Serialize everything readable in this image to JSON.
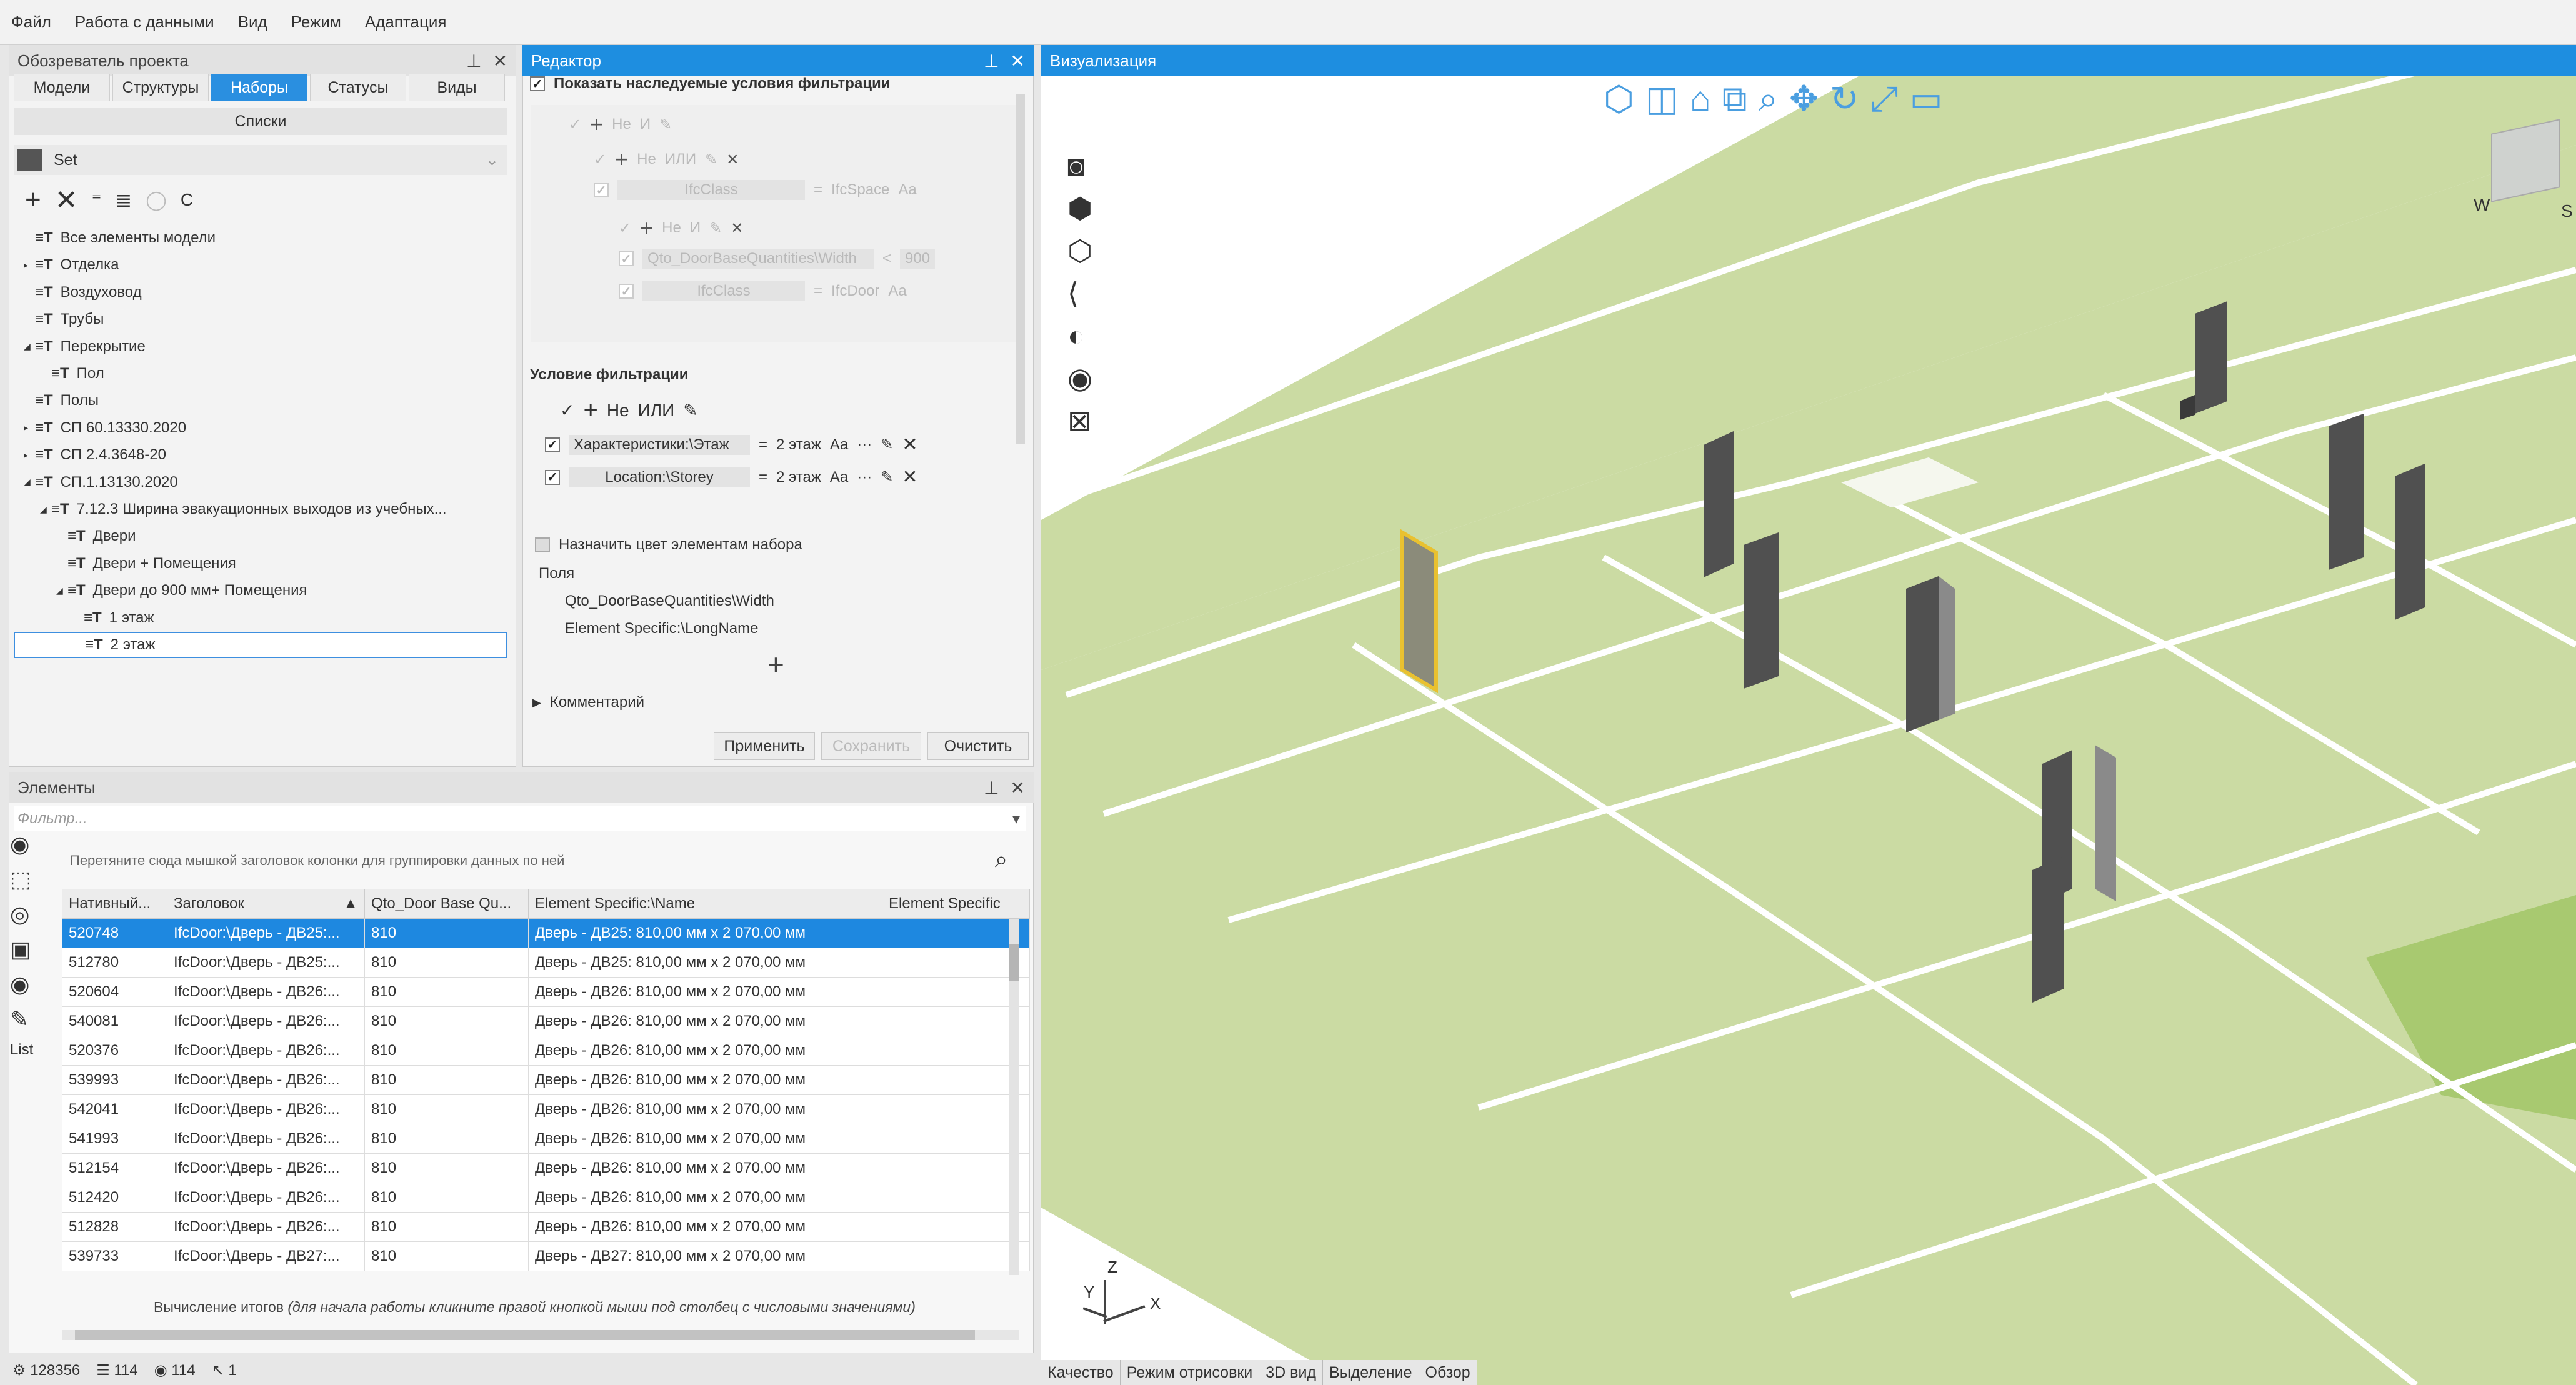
{
  "menu": [
    "Файл",
    "Работа с данными",
    "Вид",
    "Режим",
    "Адаптация"
  ],
  "explorer": {
    "title": "Обозреватель проекта",
    "tabs": [
      "Модели",
      "Структуры",
      "Наборы",
      "Статусы",
      "Виды"
    ],
    "active_tab": "Наборы",
    "subheader": "Списки",
    "set_label": "Set",
    "toolbar_c": "C",
    "tree": [
      {
        "label": "Все элементы модели",
        "depth": 0
      },
      {
        "label": "Отделка",
        "depth": 0
      },
      {
        "label": "Воздуховод",
        "depth": 0
      },
      {
        "label": "Трубы",
        "depth": 0
      },
      {
        "label": "Перекрытие",
        "depth": 0
      },
      {
        "label": "Пол",
        "depth": 1
      },
      {
        "label": "Полы",
        "depth": 0
      },
      {
        "label": "СП 60.13330.2020",
        "depth": 0
      },
      {
        "label": "СП 2.4.3648-20",
        "depth": 0
      },
      {
        "label": "СП.1.13130.2020",
        "depth": 0
      },
      {
        "label": "7.12.3 Ширина эвакуационных выходов из учебных...",
        "depth": 1
      },
      {
        "label": "Двери",
        "depth": 2
      },
      {
        "label": "Двери + Помещения",
        "depth": 2
      },
      {
        "label": "Двери до 900 мм+ Помещения",
        "depth": 2
      },
      {
        "label": "1 этаж",
        "depth": 3
      },
      {
        "label": "2 этаж",
        "depth": 3
      }
    ]
  },
  "editor": {
    "title": "Редактор",
    "show_inherited": "Показать наследуемые условия фильтрации",
    "ops": {
      "not": "Не",
      "and": "И",
      "or": "ИЛИ"
    },
    "inherited": [
      {
        "field": "IfcClass",
        "value": "IfcSpace",
        "case": "Aa"
      },
      {
        "field": "Qto_DoorBaseQuantities\\Width",
        "op": "<",
        "value": "900"
      },
      {
        "field": "IfcClass",
        "value": "IfcDoor",
        "case": "Aa"
      }
    ],
    "condition_title": "Условие фильтрации",
    "conditions": [
      {
        "field": "Характеристики:\\Этаж",
        "op": "=",
        "value": "2 этаж",
        "case": "Aa"
      },
      {
        "field": "Location:\\Storey",
        "op": "=",
        "value": "2 этаж",
        "case": "Aa"
      }
    ],
    "assign_color": "Назначить цвет элементам набора",
    "fields_label": "Поля",
    "fields": [
      "Qto_DoorBaseQuantities\\Width",
      "Element Specific:\\LongName"
    ],
    "comment": "Комментарий",
    "apply": "Применить",
    "save": "Сохранить",
    "clear": "Очистить"
  },
  "elements": {
    "title": "Элементы",
    "filter_placeholder": "Фильтр...",
    "group_hint": "Перетяните сюда мышкой заголовок колонки для группировки данных по ней",
    "columns": [
      "Нативный...",
      "Заголовок",
      "Qto_Door Base Qu...",
      "Element Specific:\\Name",
      "Element Specific"
    ],
    "rows": [
      [
        "520748",
        "IfcDoor:\\Дверь - ДВ25:...",
        "810",
        "Дверь - ДВ25: 810,00 мм x 2 070,00 мм",
        ""
      ],
      [
        "512780",
        "IfcDoor:\\Дверь - ДВ25:...",
        "810",
        "Дверь - ДВ25: 810,00 мм x 2 070,00 мм",
        ""
      ],
      [
        "520604",
        "IfcDoor:\\Дверь - ДВ26:...",
        "810",
        "Дверь - ДВ26: 810,00 мм x 2 070,00 мм",
        ""
      ],
      [
        "540081",
        "IfcDoor:\\Дверь - ДВ26:...",
        "810",
        "Дверь - ДВ26: 810,00 мм x 2 070,00 мм",
        ""
      ],
      [
        "520376",
        "IfcDoor:\\Дверь - ДВ26:...",
        "810",
        "Дверь - ДВ26: 810,00 мм x 2 070,00 мм",
        ""
      ],
      [
        "539993",
        "IfcDoor:\\Дверь - ДВ26:...",
        "810",
        "Дверь - ДВ26: 810,00 мм x 2 070,00 мм",
        ""
      ],
      [
        "542041",
        "IfcDoor:\\Дверь - ДВ26:...",
        "810",
        "Дверь - ДВ26: 810,00 мм x 2 070,00 мм",
        ""
      ],
      [
        "541993",
        "IfcDoor:\\Дверь - ДВ26:...",
        "810",
        "Дверь - ДВ26: 810,00 мм x 2 070,00 мм",
        ""
      ],
      [
        "512154",
        "IfcDoor:\\Дверь - ДВ26:...",
        "810",
        "Дверь - ДВ26: 810,00 мм x 2 070,00 мм",
        ""
      ],
      [
        "512420",
        "IfcDoor:\\Дверь - ДВ26:...",
        "810",
        "Дверь - ДВ26: 810,00 мм x 2 070,00 мм",
        ""
      ],
      [
        "512828",
        "IfcDoor:\\Дверь - ДВ26:...",
        "810",
        "Дверь - ДВ26: 810,00 мм x 2 070,00 мм",
        ""
      ],
      [
        "539733",
        "IfcDoor:\\Дверь - ДВ27:...",
        "810",
        "Дверь - ДВ27: 810,00 мм x 2 070,00 мм",
        ""
      ]
    ],
    "totals_hint": "Вычисление итогов",
    "totals_hint_italic": "(для начала работы кликните правой кнопкой мыши под столбец с числовыми значениями)",
    "list_label": "List"
  },
  "status": {
    "total": "128356",
    "listed": "114",
    "visible": "114",
    "selected": "1"
  },
  "viz": {
    "title": "Визуализация",
    "tabs": [
      "Качество",
      "Режим отрисовки",
      "3D вид",
      "Выделение",
      "Обзор"
    ],
    "axis": {
      "z": "Z",
      "y": "Y",
      "x": "X"
    },
    "cube": {
      "w": "W",
      "s": "S"
    },
    "colors": {
      "floor": "#cbdba3",
      "door": "#4f4f4f",
      "highlight": "#e9c130",
      "accent": "#1e8ee0"
    }
  }
}
